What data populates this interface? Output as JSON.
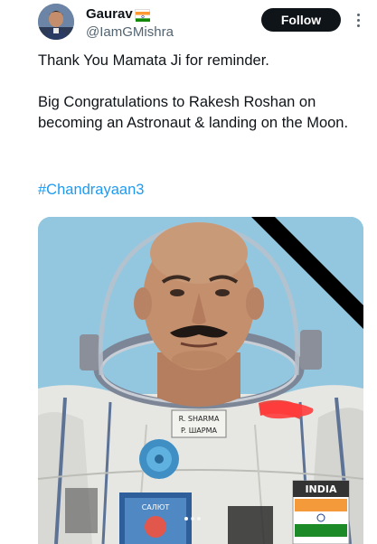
{
  "user": {
    "display_name": "Gaurav",
    "flag_icon": "india-flag-icon",
    "handle": "@IamGMishra"
  },
  "actions": {
    "follow_label": "Follow",
    "more_icon": "more-options-icon"
  },
  "tweet": {
    "line1": "Thank You Mamata Ji for reminder.",
    "line2": "Big Congratulations to Rakesh Roshan  on becoming an Astronaut & landing on the Moon.",
    "hashtag": "#Chandrayaan3"
  },
  "media": {
    "badge_name_latin": "R. SHARMA",
    "badge_name_cyrillic": "P. ШАРМА",
    "patch_text": "САЛЮТ",
    "shoulder_patch": "INDIA",
    "carousel_pages": 3
  },
  "colors": {
    "follow_bg": "#0f1419",
    "hashtag": "#1d9bf0",
    "text": "#0f1419",
    "secondary_text": "#536471"
  }
}
